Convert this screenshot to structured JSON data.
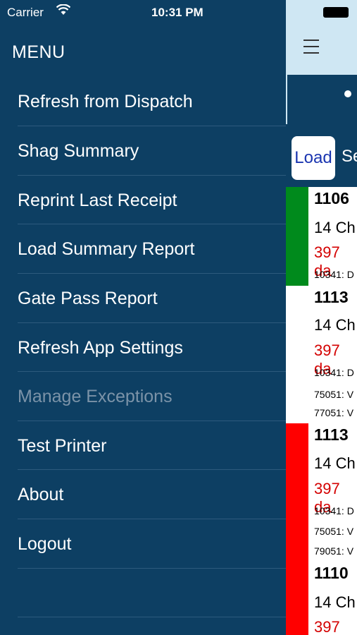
{
  "status_bar": {
    "carrier": "Carrier",
    "time": "10:31 PM"
  },
  "menu": {
    "title": "MENU",
    "items": [
      {
        "label": "Refresh from Dispatch",
        "enabled": true
      },
      {
        "label": "Shag Summary",
        "enabled": true
      },
      {
        "label": "Reprint Last Receipt",
        "enabled": true
      },
      {
        "label": "Load Summary Report",
        "enabled": true
      },
      {
        "label": "Gate Pass Report",
        "enabled": true
      },
      {
        "label": "Refresh App Settings",
        "enabled": true
      },
      {
        "label": "Manage Exceptions",
        "enabled": false
      },
      {
        "label": "Test Printer",
        "enabled": true
      },
      {
        "label": "About",
        "enabled": true
      },
      {
        "label": "Logout",
        "enabled": true
      }
    ]
  },
  "main": {
    "load_button": "Load",
    "search_partial": "Se",
    "rows": [
      {
        "id": "1106",
        "line2": "14 Ch",
        "line3": "397 da",
        "lines_small": [
          "10341: D"
        ],
        "status_color": "#008a1c"
      },
      {
        "id": "1113",
        "line2": "14 Ch",
        "line3": "397 da",
        "lines_small": [
          "10341: D",
          "75051: V",
          "77051: V"
        ],
        "status_color": "#ffffff"
      },
      {
        "id": "1113",
        "line2": "14 Ch",
        "line3": "397 da",
        "lines_small": [
          "10341: D",
          "75051: V",
          "79051: V"
        ],
        "status_color": "#ff0000"
      },
      {
        "id": "1110",
        "line2": "14 Ch",
        "line3": "397 da",
        "lines_small": [],
        "status_color": "#ff0000"
      }
    ]
  }
}
